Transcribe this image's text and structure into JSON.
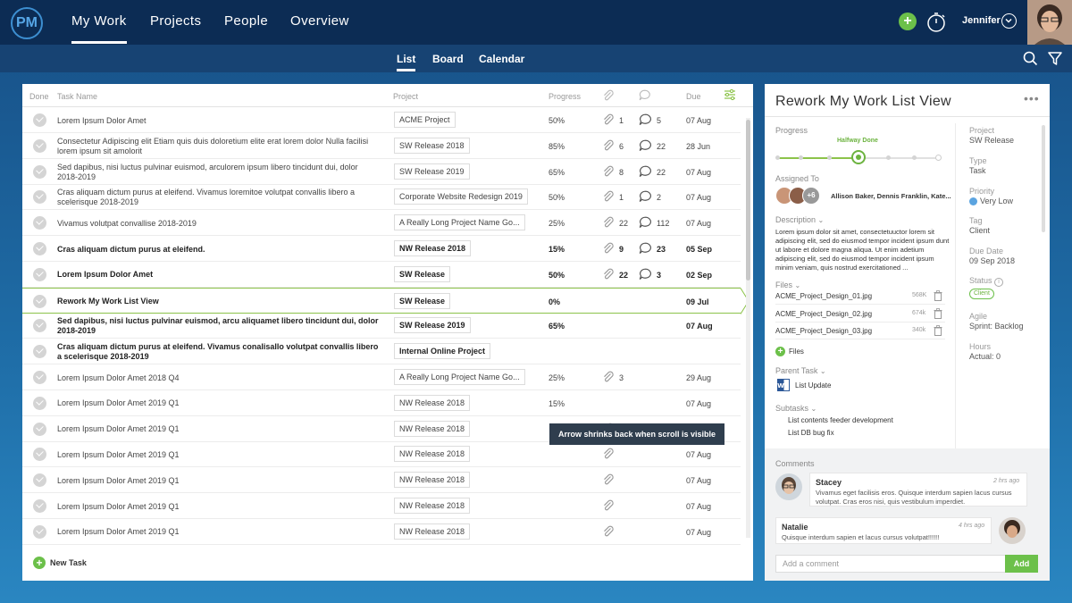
{
  "app": {
    "logo_text": "PM"
  },
  "nav": {
    "items": [
      "My Work",
      "Projects",
      "People",
      "Overview"
    ],
    "user_name": "Jennifer",
    "add_label": "+"
  },
  "subnav": {
    "tabs": [
      "List",
      "Board",
      "Calendar"
    ]
  },
  "list": {
    "columns": {
      "done": "Done",
      "task": "Task Name",
      "project": "Project",
      "progress": "Progress",
      "due": "Due"
    },
    "rows": [
      {
        "task": "Lorem Ipsum Dolor Amet",
        "project": "ACME Project",
        "progress": "50%",
        "attachments": "1",
        "comments": "5",
        "due": "07 Aug"
      },
      {
        "task": "Consectetur Adipiscing elit Etiam quis duis doloretium elite erat lorem dolor Nulla facilisi lorem ipsum sit amolorit",
        "project": "SW Release 2018",
        "progress": "85%",
        "attachments": "6",
        "comments": "22",
        "due": "28 Jun"
      },
      {
        "task": "Sed dapibus, nisi luctus pulvinar euismod, arculorem ipsum libero tincidunt dui, dolor 2018-2019",
        "project": "SW Release 2019",
        "progress": "65%",
        "attachments": "8",
        "comments": "22",
        "due": "07 Aug"
      },
      {
        "task": "Cras aliquam dictum purus at eleifend. Vivamus loremitoe volutpat convallis libero a scelerisque 2018-2019",
        "project": "Corporate Website Redesign 2019",
        "progress": "50%",
        "attachments": "1",
        "comments": "2",
        "due": "07 Aug"
      },
      {
        "task": "Vivamus volutpat convallise 2018-2019",
        "project": "A Really Long Project Name Go...",
        "progress": "25%",
        "attachments": "22",
        "comments": "112",
        "due": "07 Aug"
      },
      {
        "task": "Cras aliquam dictum purus at eleifend.",
        "project": "NW Release 2018",
        "progress": "15%",
        "attachments": "9",
        "comments": "23",
        "due": "05 Sep"
      },
      {
        "task": "Lorem Ipsum Dolor Amet",
        "project": "SW Release",
        "progress": "50%",
        "attachments": "22",
        "comments": "3",
        "due": "02 Sep"
      },
      {
        "task": "Rework My Work List View",
        "project": "SW Release",
        "progress": "0%",
        "attachments": "",
        "comments": "",
        "due": "09 Jul"
      },
      {
        "task": "Sed dapibus, nisi luctus pulvinar euismod, arcu aliquamet libero tincidunt dui, dolor 2018-2019",
        "project": "SW Release 2019",
        "progress": "65%",
        "attachments": "",
        "comments": "",
        "due": "07 Aug"
      },
      {
        "task": "Cras aliquam dictum purus at eleifend. Vivamus conalisallo volutpat convallis libero a scelerisque 2018-2019",
        "project": "Internal Online Project",
        "progress": "",
        "attachments": "",
        "comments": "",
        "due": ""
      },
      {
        "task": "Lorem Ipsum Dolor Amet 2018 Q4",
        "project": "A Really Long Project Name Go...",
        "progress": "25%",
        "attachments": "3",
        "comments": "",
        "due": "29 Aug"
      },
      {
        "task": "Lorem Ipsum Dolor Amet 2019 Q1",
        "project": "NW Release 2018",
        "progress": "15%",
        "attachments": "",
        "comments": "",
        "due": "07 Aug"
      },
      {
        "task": "Lorem Ipsum Dolor Amet 2019 Q1",
        "project": "NW Release 2018",
        "progress": "",
        "attachments": "",
        "comments": "",
        "due": "07 Aug"
      },
      {
        "task": "Lorem Ipsum Dolor Amet 2019 Q1",
        "project": "NW Release 2018",
        "progress": "",
        "attachments": "",
        "comments": "",
        "due": "07 Aug"
      },
      {
        "task": "Lorem Ipsum Dolor Amet 2019 Q1",
        "project": "NW Release 2018",
        "progress": "",
        "attachments": "",
        "comments": "",
        "due": "07 Aug"
      },
      {
        "task": "Lorem Ipsum Dolor Amet 2019 Q1",
        "project": "NW Release 2018",
        "progress": "",
        "attachments": "",
        "comments": "",
        "due": "07 Aug"
      },
      {
        "task": "Lorem Ipsum Dolor Amet 2019 Q1",
        "project": "NW Release 2018",
        "progress": "",
        "attachments": "",
        "comments": "",
        "due": "07 Aug"
      }
    ],
    "tooltip": "Arrow shrinks back when scroll is visible",
    "new_task": "New Task"
  },
  "detail": {
    "title": "Rework My Work List View",
    "more": "•••",
    "progress_label": "Progress",
    "progress_value": "Halfway Done",
    "assigned_label": "Assigned To",
    "assigned_more": "+6",
    "assigned_names": "Allison Baker, Dennis Franklin, Kate...",
    "description_label": "Description",
    "description_text": "Lorem ipsum dolor sit amet, consectetuuctor lorem sit adipiscing elit, sed do eiusmod tempor incident ipsum dunt ut labore et dolore magna aliqua. Ut enim adetium adipiscing elit, sed do eiusmod tempor incident ipsum minim veniam, quis nostrud exercitationed ...",
    "files_label": "Files",
    "files": [
      {
        "name": "ACME_Project_Design_01.jpg",
        "size": "568K"
      },
      {
        "name": "ACME_Project_Design_02.jpg",
        "size": "674k"
      },
      {
        "name": "ACME_Project_Design_03.jpg",
        "size": "340k"
      }
    ],
    "add_files_label": "Files",
    "parent_label": "Parent Task",
    "parent_value": "List Update",
    "subtasks_label": "Subtasks",
    "subtasks": [
      "List contents feeder development",
      "List DB bug fix"
    ],
    "side": {
      "project_label": "Project",
      "project_value": "SW Release",
      "type_label": "Type",
      "type_value": "Task",
      "priority_label": "Priority",
      "priority_value": "Very Low",
      "tag_label": "Tag",
      "tag_value": "Client",
      "due_label": "Due Date",
      "due_value": "09 Sep 2018",
      "status_label": "Status",
      "status_value": "Client",
      "agile_label": "Agile",
      "agile_value": "Sprint: Backlog",
      "hours_label": "Hours",
      "hours_value": "Actual: 0"
    },
    "comments_label": "Comments",
    "comments": [
      {
        "name": "Stacey",
        "time": "2 hrs ago",
        "text": "Vivamus eget facilisis eros. Quisque interdum sapien lacus cursus volutpat. Cras eros nisi, quis vestibulum imperdiet."
      },
      {
        "name": "Natalie",
        "time": "4 hrs ago",
        "text": "Quisque interdum sapien et lacus cursus volutpat!!!!!!"
      }
    ],
    "comment_placeholder": "Add a comment",
    "add_button": "Add"
  },
  "colors": {
    "accent_green": "#6cc04a",
    "nav_dark": "#0c2c54",
    "sub_nav": "#174373"
  }
}
